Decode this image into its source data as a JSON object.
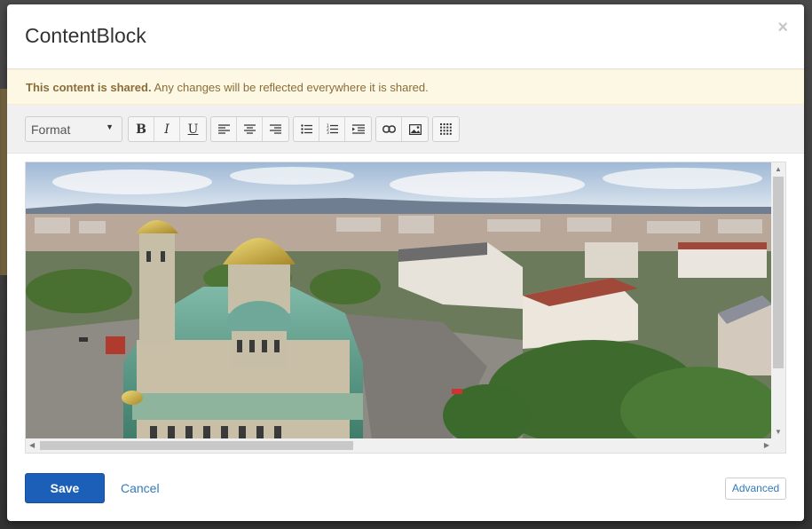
{
  "modal": {
    "title": "ContentBlock",
    "close_glyph": "×"
  },
  "alert": {
    "strong": "This content is shared.",
    "message": " Any changes will be reflected everywhere it is shared."
  },
  "toolbar": {
    "format_label": "Format",
    "format_caret": "▼",
    "buttons": {
      "bold": "B",
      "italic": "I",
      "underline": "U"
    },
    "icons": [
      "bold-icon",
      "italic-icon",
      "underline-icon",
      "align-left-icon",
      "align-center-icon",
      "align-right-icon",
      "bullet-list-icon",
      "numbered-list-icon",
      "indent-icon",
      "link-icon",
      "image-icon",
      "table-icon"
    ]
  },
  "editor": {
    "image_subject": "panoramic-city-photo"
  },
  "footer": {
    "save_label": "Save",
    "cancel_label": "Cancel",
    "advanced_label": "Advanced"
  },
  "colors": {
    "primary": "#1b5fb8",
    "link": "#337ab7",
    "alert_bg": "#fcf8e3",
    "alert_text": "#8a6d3b"
  }
}
